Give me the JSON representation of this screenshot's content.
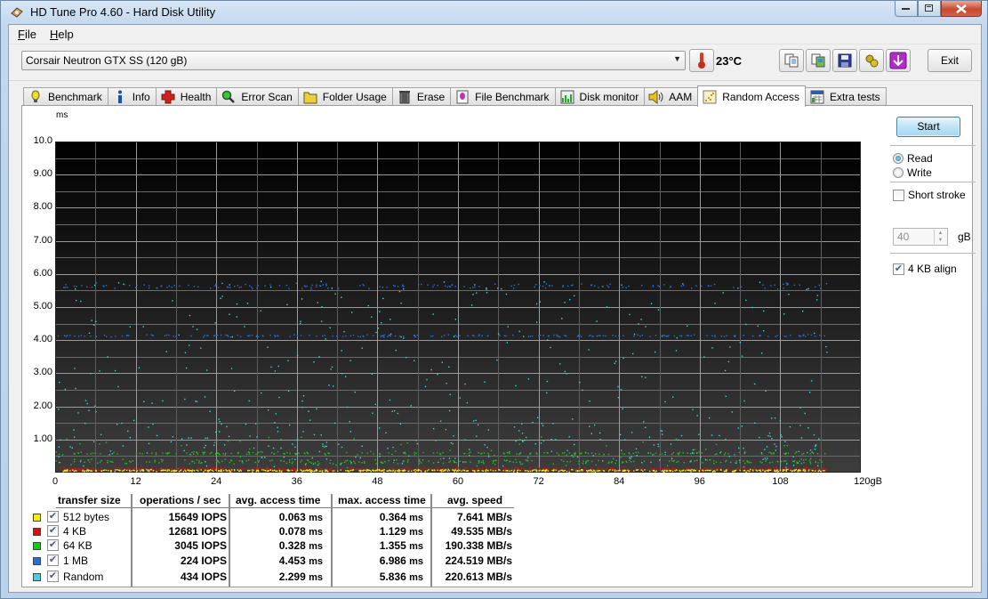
{
  "window": {
    "title": "HD Tune Pro 4.60 - Hard Disk Utility",
    "icon": "hdd-icon",
    "controls": [
      "minimize",
      "maximize",
      "close"
    ]
  },
  "menu": [
    {
      "label": "File",
      "accel": "F"
    },
    {
      "label": "Help",
      "accel": "H"
    }
  ],
  "toolbar": {
    "drive": "Corsair Neutron GTX SS (120 gB)",
    "temperature": "23°C",
    "icons": [
      "copy-text-icon",
      "copy-screenshot-icon",
      "save-icon",
      "options-icon",
      "download-icon"
    ],
    "exit_label": "Exit"
  },
  "tabs": [
    {
      "label": "Benchmark",
      "icon": "lightbulb-icon"
    },
    {
      "label": "Info",
      "icon": "info-icon"
    },
    {
      "label": "Health",
      "icon": "health-cross-icon"
    },
    {
      "label": "Error Scan",
      "icon": "magnifier-icon"
    },
    {
      "label": "Folder Usage",
      "icon": "folder-icon"
    },
    {
      "label": "Erase",
      "icon": "trash-icon"
    },
    {
      "label": "File Benchmark",
      "icon": "file-benchmark-icon"
    },
    {
      "label": "Disk monitor",
      "icon": "disk-monitor-icon"
    },
    {
      "label": "AAM",
      "icon": "speaker-icon"
    },
    {
      "label": "Random Access",
      "icon": "scatter-icon",
      "active": true
    },
    {
      "label": "Extra tests",
      "icon": "extra-tests-icon"
    }
  ],
  "side": {
    "start_label": "Start",
    "mode_options": [
      {
        "label": "Read",
        "selected": true
      },
      {
        "label": "Write",
        "selected": false
      }
    ],
    "short_stroke": {
      "label": "Short stroke",
      "checked": false,
      "value": "40",
      "unit": "gB"
    },
    "align_4kb": {
      "label": "4 KB align",
      "checked": true
    }
  },
  "results": {
    "headers": [
      "transfer size",
      "operations / sec",
      "avg. access time",
      "max. access time",
      "avg. speed"
    ],
    "rows": [
      {
        "name": "512 bytes",
        "color": "#f2e62a",
        "checked": true,
        "iops": "15649",
        "iops_unit": "IOPS",
        "avg": "0.063",
        "max": "0.364",
        "time_unit": "ms",
        "speed": "7.641",
        "speed_unit": "MB/s"
      },
      {
        "name": "4 KB",
        "color": "#c81414",
        "checked": true,
        "iops": "12681",
        "iops_unit": "IOPS",
        "avg": "0.078",
        "max": "1.129",
        "time_unit": "ms",
        "speed": "49.535",
        "speed_unit": "MB/s"
      },
      {
        "name": "64 KB",
        "color": "#22c022",
        "checked": true,
        "iops": "3045",
        "iops_unit": "IOPS",
        "avg": "0.328",
        "max": "1.355",
        "time_unit": "ms",
        "speed": "190.338",
        "speed_unit": "MB/s"
      },
      {
        "name": "1 MB",
        "color": "#2a6fd0",
        "checked": true,
        "iops": "224",
        "iops_unit": "IOPS",
        "avg": "4.453",
        "max": "6.986",
        "time_unit": "ms",
        "speed": "224.519",
        "speed_unit": "MB/s"
      },
      {
        "name": "Random",
        "color": "#3fd6d6",
        "checked": true,
        "iops": "434",
        "iops_unit": "IOPS",
        "avg": "2.299",
        "max": "5.836",
        "time_unit": "ms",
        "speed": "220.613",
        "speed_unit": "MB/s"
      }
    ]
  },
  "chart_data": {
    "type": "scatter",
    "title": "",
    "ylabel": "ms",
    "xlabel": "gB",
    "ylim": [
      0,
      10
    ],
    "xlim": [
      0,
      120
    ],
    "grid": true,
    "y_ticks": [
      "10.0",
      "9.00",
      "8.00",
      "7.00",
      "6.00",
      "5.00",
      "4.00",
      "3.00",
      "2.00",
      "1.00"
    ],
    "x_ticks": [
      "0",
      "12",
      "24",
      "36",
      "48",
      "60",
      "72",
      "84",
      "96",
      "108",
      "120gB"
    ],
    "x_data_extent": [
      0,
      115
    ],
    "series": [
      {
        "name": "512 bytes",
        "color": "#f2e62a",
        "bands": [
          {
            "y": 0.08,
            "spread": 0.05
          }
        ],
        "max": 0.364
      },
      {
        "name": "4 KB",
        "color": "#c81414",
        "bands": [
          {
            "y": 0.12,
            "spread": 0.08
          }
        ],
        "max": 1.129
      },
      {
        "name": "64 KB",
        "color": "#22c022",
        "bands": [
          {
            "y": 0.35,
            "spread": 0.1
          },
          {
            "y": 0.6,
            "spread": 0.06
          }
        ],
        "max": 1.355
      },
      {
        "name": "1 MB",
        "color": "#2a6fd0",
        "bands": [
          {
            "y": 4.15,
            "spread": 0.05
          },
          {
            "y": 5.65,
            "spread": 0.12
          }
        ],
        "max": 6.986
      },
      {
        "name": "Random",
        "color": "#3fd6d6",
        "bands": [
          {
            "y": 0.2,
            "spread": 5.6,
            "uniform": true
          }
        ],
        "max": 5.836
      }
    ]
  }
}
